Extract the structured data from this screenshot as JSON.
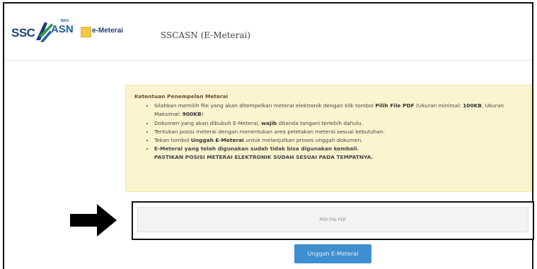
{
  "header": {
    "logo_ssc": "SSC",
    "logo_asn": "ASN",
    "logo_asn_sup": "BKN",
    "logo_emeterai": "e-Meterai",
    "title": "SSCASN (E-Meterai)"
  },
  "notice": {
    "title": "Ketentuan Penempelan Meterai",
    "item1_pre": "Silahkan memilih file yang akan ditempelkan meterai elektronik dengan klik tombol ",
    "item1_bold": "Pilih File PDF",
    "item1_mid": " (Ukuran minimal: ",
    "item1_min": "100KB",
    "item1_mid2": ", Ukuran Maksimal: ",
    "item1_max": "900KB",
    "item1_end": ")",
    "item2_pre": "Dokumen yang akan dibubuh E-Meterai, ",
    "item2_bold": "wajib",
    "item2_end": " ditanda tangani terlebih dahulu.",
    "item3": "Tentukan posisi meterai dengan menentukan area peletakan meterai sesuai kebutuhan.",
    "item4_pre": "Tekan tombol ",
    "item4_bold": "Unggah E-Meterai",
    "item4_end": " untuk melanjutkan proses unggah dokumen.",
    "item5_line1": "E-Meterai yang telah digunakan sudah tidak bisa digunakan kembali.",
    "item5_line2": "PASTIKAN POSISI METERAI ELEKTRONIK SUDAH SESUAI PADA TEMPATNYA."
  },
  "file_button_label": "Pilih File PDF",
  "upload_button_label": "Unggah E-Meterai",
  "colors": {
    "notice_bg": "#fcf4cf",
    "upload_button": "#3e8ed0",
    "brand_blue": "#1f3e77",
    "emeterai_yellow": "#f2c94c"
  },
  "icons": {
    "annotation_arrow": "arrow-right-icon"
  }
}
